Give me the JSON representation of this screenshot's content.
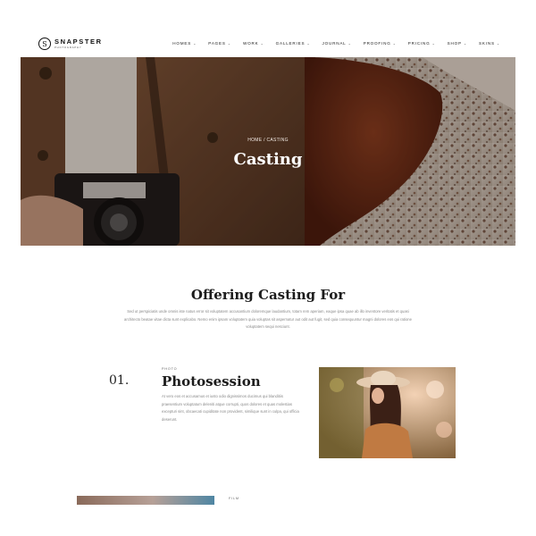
{
  "brand": {
    "name": "SNAPSTER",
    "tagline": "PHOTOGRAPHY",
    "mark": "S"
  },
  "nav": {
    "items": [
      {
        "label": "HOMES"
      },
      {
        "label": "PAGES"
      },
      {
        "label": "WORK"
      },
      {
        "label": "GALLERIES"
      },
      {
        "label": "JOURNAL"
      },
      {
        "label": "PROOFING"
      },
      {
        "label": "PRICING"
      },
      {
        "label": "SHOP"
      },
      {
        "label": "SKINS"
      }
    ],
    "caret": "⌄"
  },
  "hero": {
    "breadcrumb": "HOME / CASTING",
    "title": "Casting"
  },
  "intro": {
    "title": "Offering Casting For",
    "text": "Sed ut perspiciatis unde omnis iste natus error sit voluptatem accusantium doloremque laudantium, totam rem aperiam, eaque ipsa quae ab illo inventore veritatis et quasi architecto beatae vitae dicta sunt explicabo. Nemo enim ipsam voluptatem quia voluptas sit aspernatur aut odit aut fugit, sed quia consequuntur magni dolores eos qui ratione voluptatem sequi nesciunt."
  },
  "items": [
    {
      "number": "01.",
      "category": "PHOTO",
      "title": "Photosession",
      "text": "At vero eos et accusamus et iusto odio dignissimos ducimus qui blanditiis praesentium voluptatum deleniti atque corrupti, quos dolores et quas molestias excepturi sint, obcaecati cupiditate non provident, similique sunt in culpa, qui officia deserunt."
    },
    {
      "category": "FILM"
    }
  ],
  "colors": {
    "text_dark": "#1c1c1c",
    "text_muted": "#8a8a8a",
    "hero_tint": "#5a3a28"
  }
}
